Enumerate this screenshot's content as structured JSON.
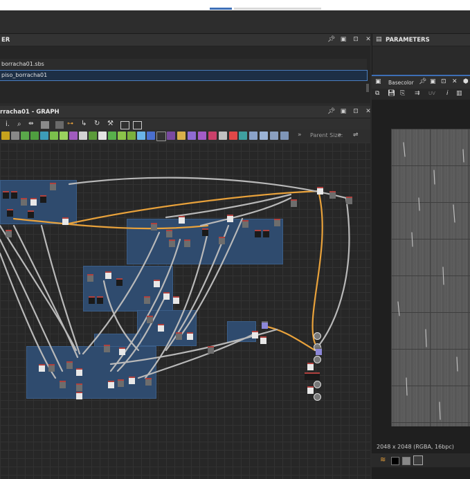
{
  "window": {
    "accent_color": "#3d6fb6"
  },
  "explorer": {
    "title": "ER",
    "package_file": "borracha01.sbs",
    "graph_item": "piso_borracha01"
  },
  "graph_panel": {
    "title": "rracha01 - GRAPH",
    "toolbar": {
      "overflow_label": "»",
      "parent_size_label": "Parent Size:",
      "parent_size_overflow": "»"
    }
  },
  "parameters": {
    "title": "PARAMETERS"
  },
  "view2d": {
    "tab_label": "Basecolor",
    "status": "2048 x 2048 (RGBA, 16bpc)"
  },
  "colors": {
    "connection_orange": "#e9a23b",
    "connection_gray": "#b9b9b9",
    "frame_blue": "#2f4b6e",
    "node_header_red": "#b0413e"
  }
}
